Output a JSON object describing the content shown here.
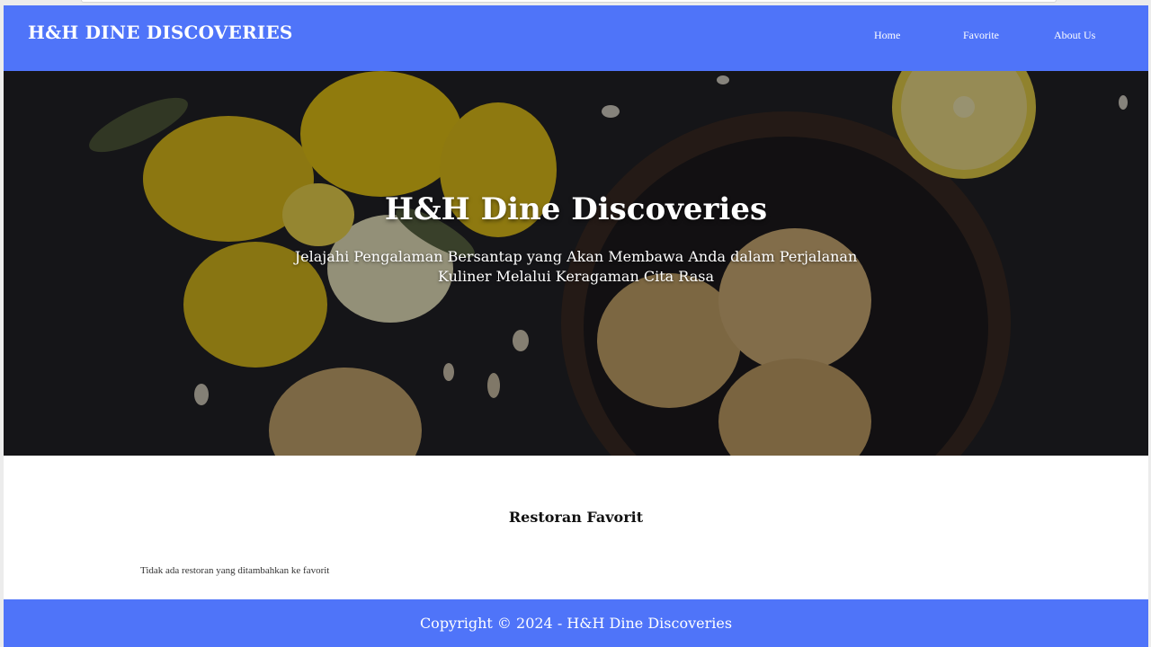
{
  "header": {
    "brand": "H&H DINE DISCOVERIES",
    "nav": {
      "home": "Home",
      "favorite": "Favorite",
      "about": "About Us"
    }
  },
  "hero": {
    "title": "H&H Dine Discoveries",
    "subtitle": "Jelajahi Pengalaman Bersantap yang Akan Membawa Anda dalam Perjalanan Kuliner Melalui Keragaman Cita Rasa"
  },
  "main": {
    "section_title": "Restoran Favorit",
    "empty_message": "Tidak ada restoran yang ditambahkan ke favorit"
  },
  "footer": {
    "copyright": "Copyright © 2024 - H&H Dine Discoveries"
  },
  "colors": {
    "primary": "#4f74f9",
    "text_dark": "#111111"
  }
}
